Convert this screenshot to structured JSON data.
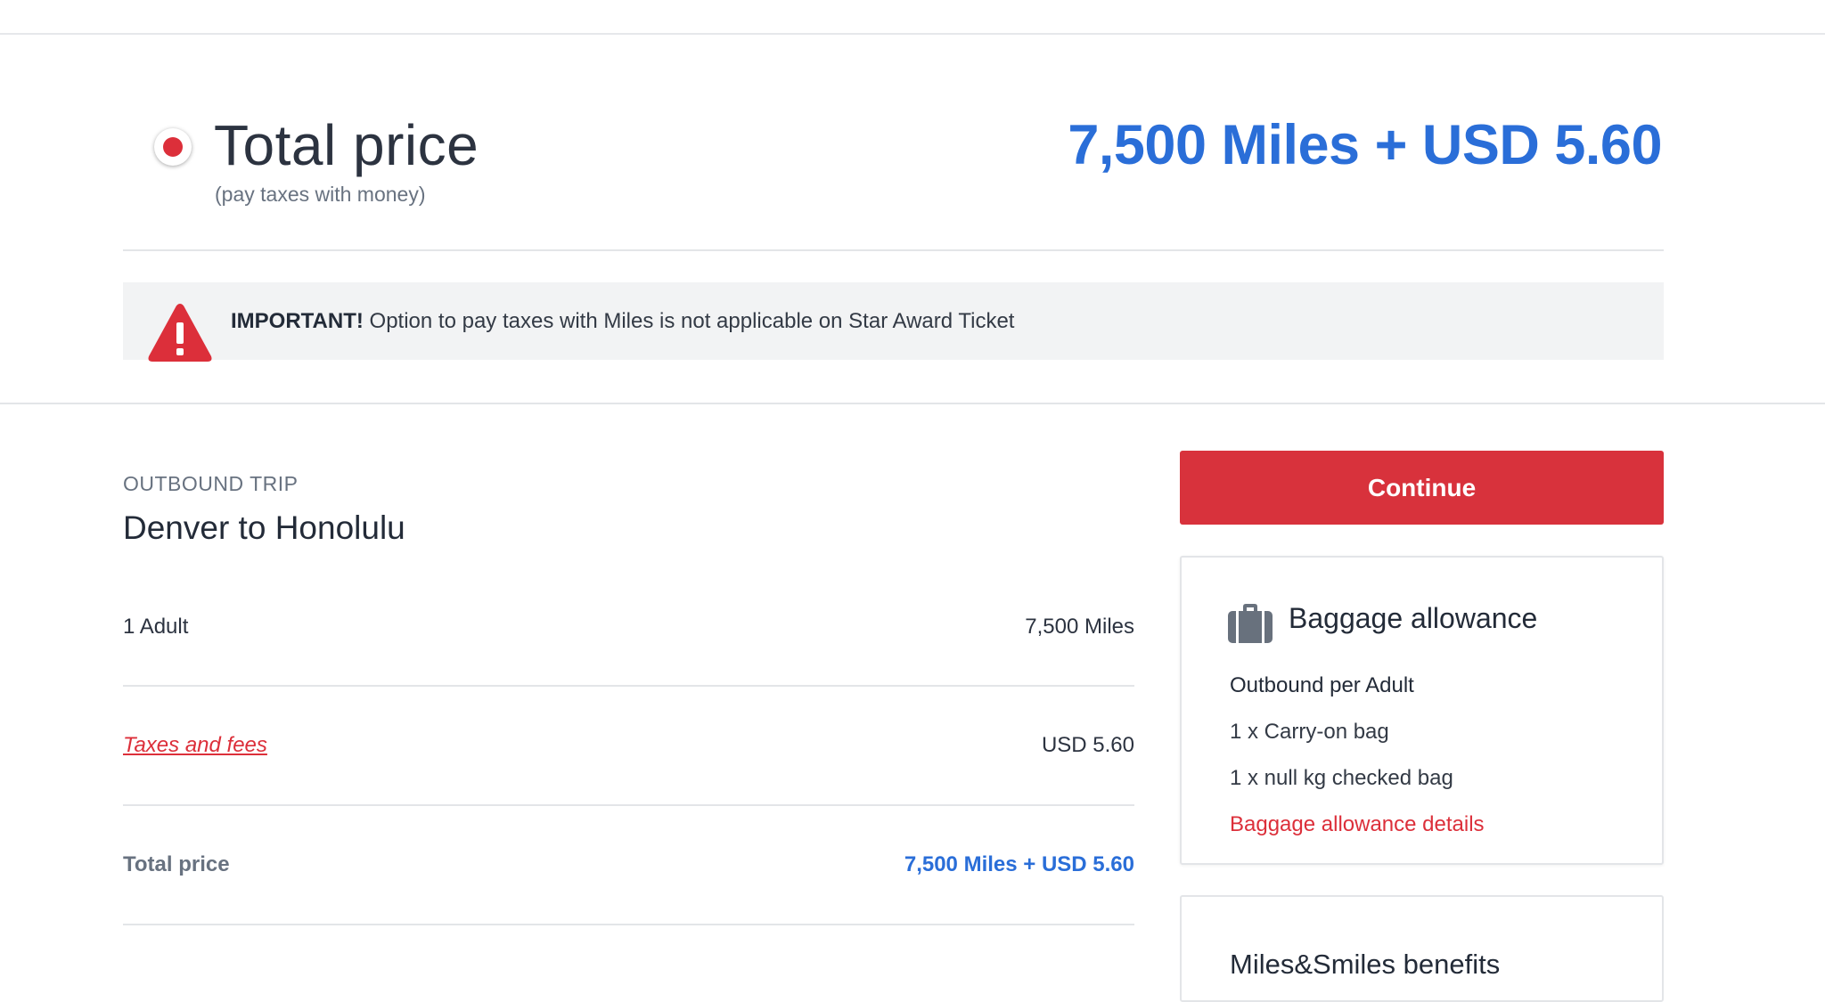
{
  "fare": {
    "option_title": "Total price",
    "option_subtitle": "(pay taxes with money)",
    "option_amount": "7,500 Miles + USD 5.60",
    "option_selected": true
  },
  "notice": {
    "bold": "IMPORTANT!",
    "text": " Option to pay taxes with Miles is not applicable on Star Award Ticket"
  },
  "trip": {
    "label": "OUTBOUND TRIP",
    "route": "Denver to Honolulu",
    "rows": [
      {
        "label": "1 Adult",
        "value": "7,500 Miles"
      },
      {
        "label": "Taxes and fees",
        "value": "USD  5.60"
      },
      {
        "label": "Total price",
        "value": "7,500 Miles + USD  5.60"
      }
    ]
  },
  "actions": {
    "continue_label": "Continue"
  },
  "baggage": {
    "title": "Baggage allowance",
    "subtitle": "Outbound per Adult",
    "items": [
      "1 x Carry-on bag",
      "1 x null kg checked bag"
    ],
    "details_link": "Baggage allowance details"
  },
  "benefits": {
    "title": "Miles&Smiles benefits"
  },
  "colors": {
    "accent_red": "#d8323c",
    "price_blue": "#2a6ed8"
  }
}
